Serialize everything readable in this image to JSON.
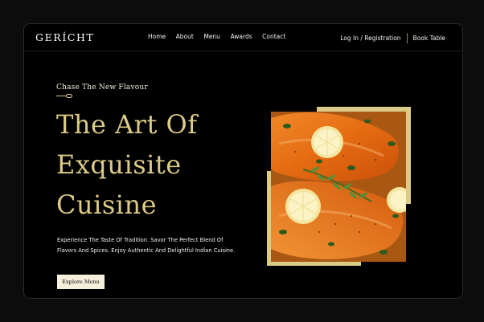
{
  "brand": {
    "logo": "GERÍCHT"
  },
  "nav": {
    "items": [
      {
        "label": "Home"
      },
      {
        "label": "About"
      },
      {
        "label": "Menu"
      },
      {
        "label": "Awards"
      },
      {
        "label": "Contact"
      }
    ]
  },
  "auth": {
    "login_label": "Log In / Registration",
    "book_label": "Book Table"
  },
  "hero": {
    "subtitle": "Chase The New Flavour",
    "title_lines": [
      "The Art Of",
      "Exquisite",
      "Cuisine"
    ],
    "description": "Experience The Taste Of Tradition. Savor The Perfect Blend Of Flavors And Spices. Enjoy Authentic And Delightful Indian Cuisine.",
    "cta_label": "Explore Menu"
  },
  "colors": {
    "accent": "#dcca87",
    "background": "#000000",
    "cream": "#f5efdb"
  },
  "icons": {
    "divider": "spoon-icon"
  }
}
